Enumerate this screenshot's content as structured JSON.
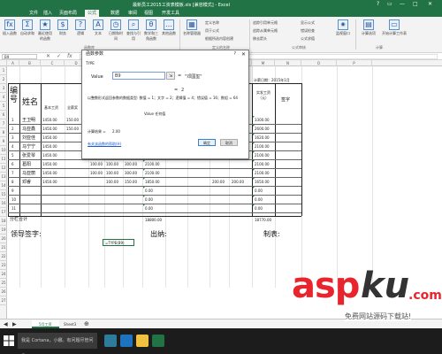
{
  "window": {
    "title": "最新员工2015工资表模板.xls [兼容模式] - Excel",
    "controls": [
      "?",
      "▭",
      "—",
      "□",
      "✕"
    ]
  },
  "ribbon_tabs": [
    "文件",
    "插入",
    "页面布局",
    "公式",
    "数据",
    "审阅",
    "视图",
    "开发工具"
  ],
  "ribbon": {
    "buttons": [
      {
        "icon": "fx",
        "label": "插入函数"
      },
      {
        "icon": "Σ",
        "label": "自动求和"
      },
      {
        "icon": "★",
        "label": "最近使用的函数"
      },
      {
        "icon": "$",
        "label": "财务"
      },
      {
        "icon": "?",
        "label": "逻辑"
      },
      {
        "icon": "A",
        "label": "文本"
      },
      {
        "icon": "◷",
        "label": "日期和时间"
      },
      {
        "icon": "⌕",
        "label": "查找与引用"
      },
      {
        "icon": "θ",
        "label": "数学和三角函数"
      },
      {
        "icon": "…",
        "label": "其他函数"
      },
      {
        "icon": "▦",
        "label": "名称管理器"
      },
      {
        "icon": "▤",
        "label": "计算选项"
      },
      {
        "icon": "▭",
        "label": "开始计算工作表"
      }
    ],
    "small_items": [
      "定义名称",
      "用于公式",
      "根据所选内容创建",
      "追踪引用单元格",
      "追踪从属单元格",
      "移去箭头",
      "显示公式",
      "错误检查",
      "公式求值",
      "监视窗口"
    ],
    "groups": [
      "函数库",
      "定义的名称",
      "公式审核",
      "计算"
    ]
  },
  "formula_bar": {
    "name_box": "B9",
    "content": "=TYPE(B9)"
  },
  "columns": [
    "A",
    "B",
    "C",
    "D",
    "E",
    "F",
    "G",
    "H",
    "I",
    "J",
    "K",
    "L",
    "M",
    "N",
    "O",
    "P"
  ],
  "rows": [
    "1",
    "2",
    "3",
    "4",
    "5",
    "6",
    "7",
    "8",
    "9",
    "10",
    "11",
    "12",
    "13",
    "14",
    "15",
    "16",
    "17",
    "18",
    "19",
    "20",
    "21",
    "22",
    "23",
    "24",
    "25",
    "26",
    "27"
  ],
  "sheet": {
    "date_label": "计薪日期：2015年1月",
    "header": {
      "number": "编号",
      "name": "姓名",
      "base_salary": "基本工资",
      "allowance": "全薪奖",
      "actual_pay": "实发工资（元）",
      "signature": "签字"
    },
    "employees": [
      {
        "no": "1",
        "name": "王卫明",
        "base": "1450.00",
        "allowance": "150.00",
        "actual": "3300.00"
      },
      {
        "no": "2",
        "name": "马亚鑫",
        "base": "1450.00",
        "allowance": "150.00",
        "actual": "2600.00"
      },
      {
        "no": "3",
        "name": "刘亚佳",
        "base": "1450.00",
        "allowance": "",
        "actual": "1620.00"
      },
      {
        "no": "4",
        "name": "马宁宁",
        "base": "1450.00",
        "allowance": "",
        "actual": "2100.00"
      },
      {
        "no": "5",
        "name": "张爱琴",
        "base": "1450.00",
        "c3": "100.00",
        "c4": "100.00",
        "c5": "300.00",
        "c6": "2100.00",
        "actual": "2100.00"
      },
      {
        "no": "6",
        "name": "葛阳",
        "base": "1450.00",
        "c3": "100.00",
        "c4": "100.00",
        "c5": "300.00",
        "c6": "2100.00",
        "actual": "2100.00"
      },
      {
        "no": "7",
        "name": "马亚丽",
        "base": "1450.00",
        "c3": "100.00",
        "c4": "100.00",
        "c5": "300.00",
        "c6": "2100.00",
        "actual": "2100.00"
      },
      {
        "no": "8",
        "name": "邓睿",
        "base": "1450.00",
        "c3": "",
        "c4": "100.00",
        "c5": "150.00",
        "c6": "1850.00",
        "j": "200.00",
        "k": "200.00",
        "actual": "1650.00"
      },
      {
        "no": "9",
        "name": "",
        "base": "",
        "c6": "0.00",
        "actual": "0.00"
      },
      {
        "no": "10",
        "name": "",
        "base": "",
        "c6": "0.00",
        "actual": "0.00"
      },
      {
        "no": "11",
        "name": "",
        "base": "",
        "c6": "0.00",
        "actual": "0.00"
      }
    ],
    "subtotal_label": "分栏合计",
    "subtotal_g": "18800.00",
    "subtotal_actual": "18770.00",
    "leader_sign": "领导签字:",
    "cashier": "出纳:",
    "preparer": "制表:",
    "active_cell_text": "=TYPE(B9)"
  },
  "dialog": {
    "title": "函数参数",
    "function_name": "TYPE",
    "arg_label": "Value",
    "arg_input": "B9",
    "eq1": "=",
    "arg_value": "\"邓國玺\"",
    "eq2": "=",
    "result_preview": "2",
    "description": "以整数形式返回参数的数据类型: 数值 = 1；文字 = 2；逻辑值 = 4；错误值 = 16；数组 = 64",
    "arg_description": "Value   任何值",
    "result_label": "计算结果 =",
    "result_value": "2.00",
    "help_link": "有关该函数的帮助(H)",
    "ok": "确定",
    "cancel": "取消"
  },
  "sheet_tabs": [
    "5月工资",
    "Sheet3"
  ],
  "taskbar": {
    "search_placeholder": "我是 Cortana，小娜。有问题尽管问我。"
  },
  "watermark": {
    "brand_red": "asp",
    "brand_dark": "ku",
    "domain": ".com",
    "subtitle": "免费网站源码下载站!"
  }
}
